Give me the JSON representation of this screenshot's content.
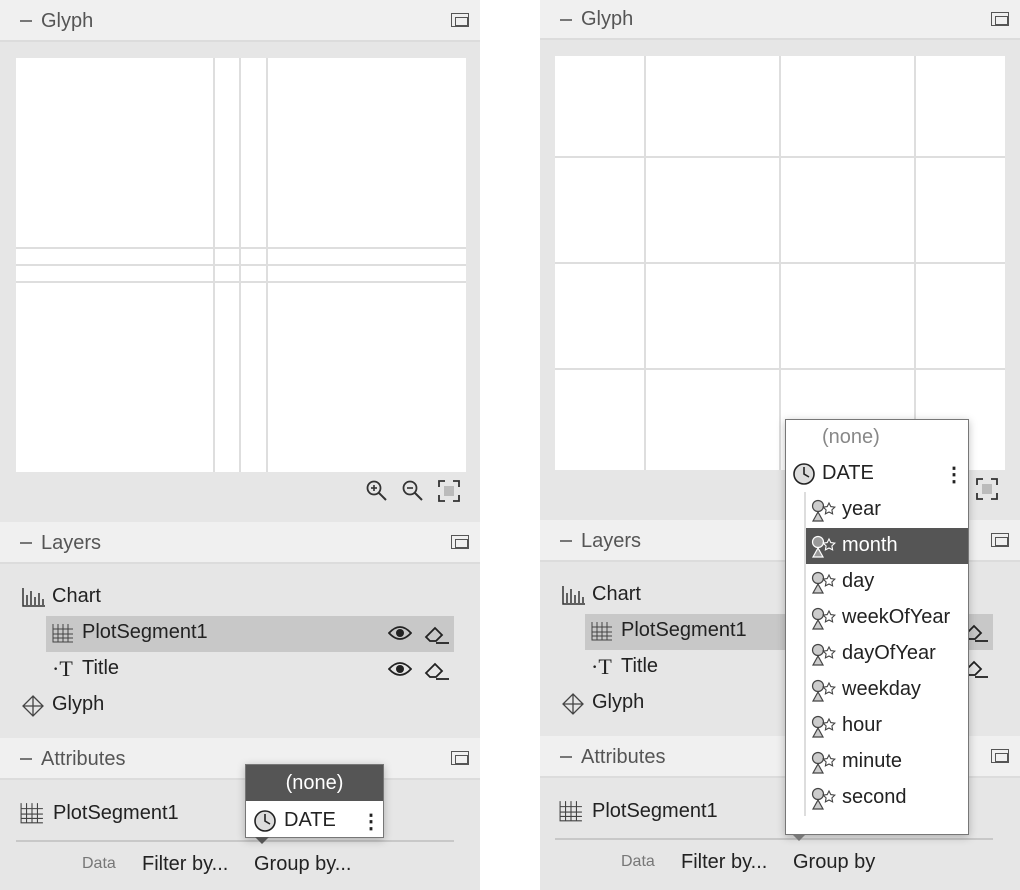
{
  "left": {
    "glyph_title": "Glyph",
    "layers_title": "Layers",
    "attributes_title": "Attributes",
    "layers": [
      "Chart",
      "PlotSegment1",
      "Title",
      "Glyph"
    ],
    "attr_name": "PlotSegment1",
    "data_label": "Data",
    "filter_label": "Filter by...",
    "group_label": "Group by...",
    "popup": {
      "none": "(none)",
      "field": "DATE"
    }
  },
  "right": {
    "glyph_title": "Glyph",
    "layers_title": "Layers",
    "attributes_title": "Attributes",
    "layers": [
      "Chart",
      "PlotSegment1",
      "Title",
      "Glyph"
    ],
    "attr_name": "PlotSegment1",
    "data_label": "Data",
    "filter_label": "Filter by...",
    "group_label": "Group by",
    "dropdown": {
      "none": "(none)",
      "field": "DATE",
      "options": [
        "year",
        "month",
        "day",
        "weekOfYear",
        "dayOfYear",
        "weekday",
        "hour",
        "minute",
        "second"
      ],
      "selected": "month"
    }
  },
  "icons": [
    "minus-icon",
    "popout-icon",
    "zoom-in-icon",
    "zoom-out-icon",
    "fit-icon",
    "chart-icon",
    "plot-segment-icon",
    "text-icon",
    "glyph-icon",
    "eye-icon",
    "eraser-icon",
    "clock-icon",
    "more-icon",
    "shapes-icon"
  ]
}
